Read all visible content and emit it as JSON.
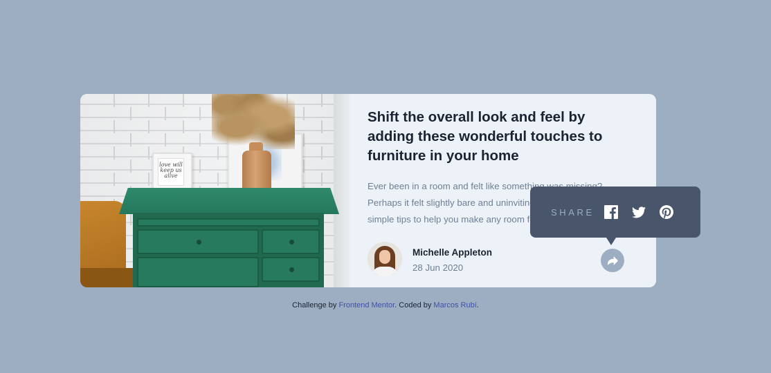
{
  "article": {
    "title": "Shift the overall look and feel by adding these wonderful touches to furniture in your home",
    "excerpt": "Ever been in a room and felt like something was missing? Perhaps it felt slightly bare and uninviting. I’ve got some simple tips to help you make any room feel complete.",
    "frame_text": "love will keep us alive"
  },
  "author": {
    "name": "Michelle Appleton",
    "date": "28 Jun 2020"
  },
  "share": {
    "label": "SHARE",
    "icons": [
      "facebook-icon",
      "twitter-icon",
      "pinterest-icon"
    ]
  },
  "footer": {
    "prefix": "Challenge by ",
    "challenge_link": "Frontend Mentor",
    "middle": ". Coded by ",
    "author_link": "Marcos Rubí",
    "suffix": "."
  },
  "colors": {
    "background": "#9daec2",
    "card": "#ecf2f8",
    "title": "#1b2330",
    "muted": "#6e7f93",
    "popup": "#48556a",
    "link": "#3e52a3"
  }
}
